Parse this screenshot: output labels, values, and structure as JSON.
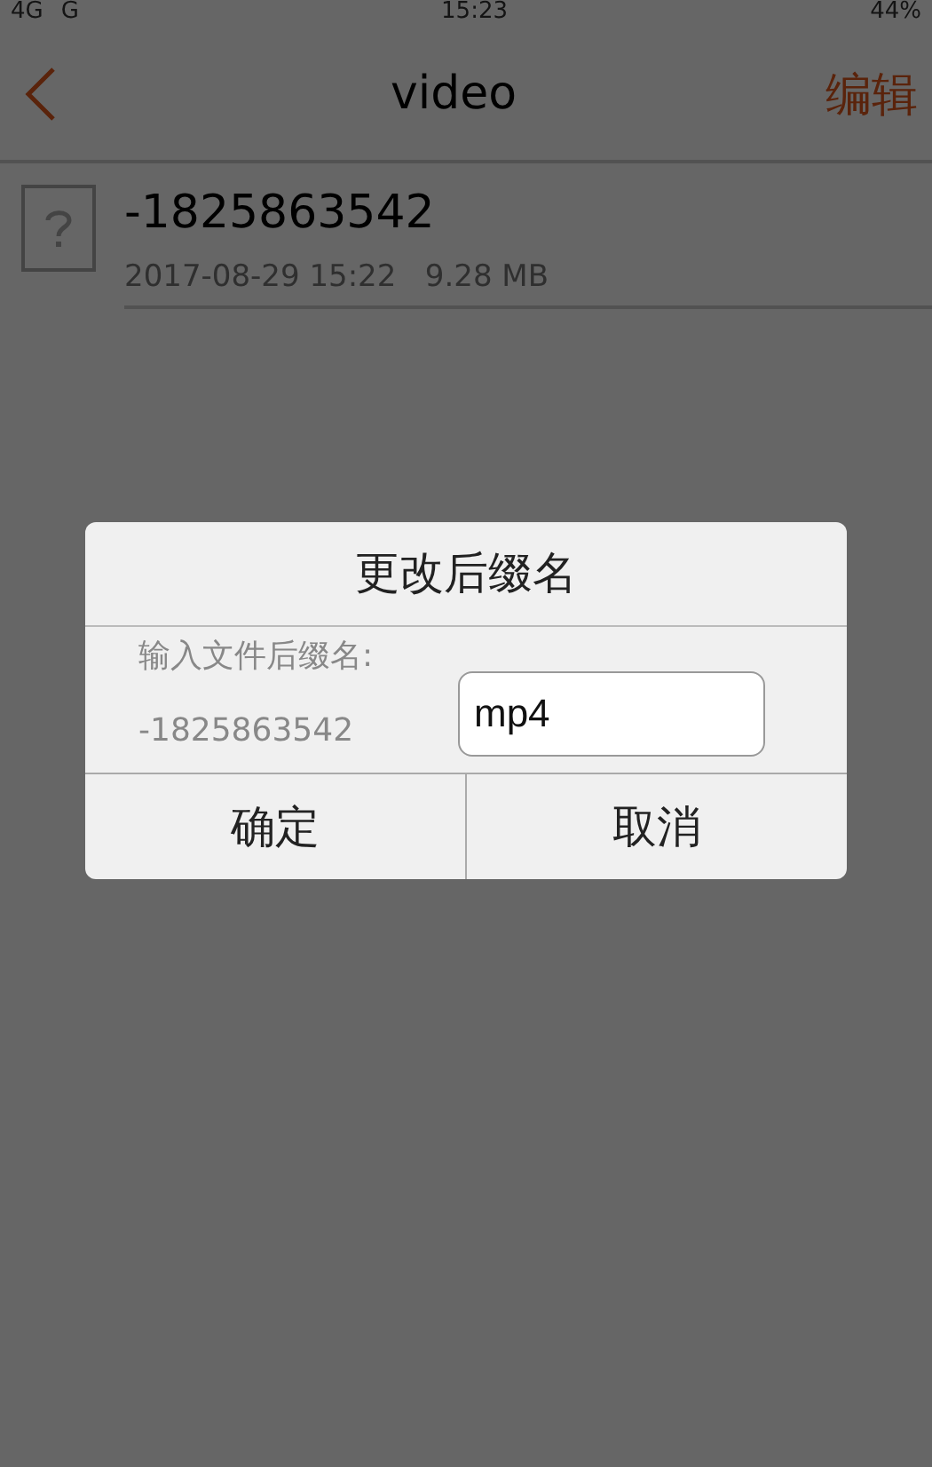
{
  "status_bar": {
    "network_1": "4G",
    "network_2": "G",
    "time": "15:23",
    "battery": "44%"
  },
  "nav": {
    "title": "video",
    "action": "编辑"
  },
  "files": [
    {
      "name": "-1825863542",
      "date": "2017-08-29 15:22",
      "size": "9.28 MB"
    }
  ],
  "dialog": {
    "title": "更改后缀名",
    "prompt": "输入文件后缀名:",
    "file_name": "-1825863542",
    "suffix": "mp4",
    "buttons": [
      "确定",
      "取消"
    ]
  }
}
